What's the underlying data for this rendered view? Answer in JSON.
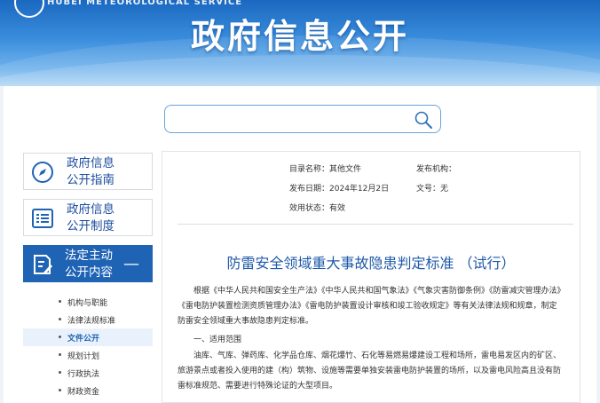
{
  "header": {
    "org_subtitle": "HUBEI METEOROLOGICAL SERVICE",
    "banner_title": "政府信息公开"
  },
  "search": {
    "value": "",
    "placeholder": ""
  },
  "sidebar": {
    "cards": [
      {
        "line1": "政府信息",
        "line2": "公开指南",
        "icon": "compass-icon"
      },
      {
        "line1": "政府信息",
        "line2": "公开制度",
        "icon": "list-document-icon"
      },
      {
        "line1": "法定主动",
        "line2": "公开内容",
        "icon": "edit-document-icon",
        "expanded_marker": "—"
      }
    ],
    "sub_items": [
      "机构与职能",
      "法律法规标准",
      "文件公开",
      "规划计划",
      "行政执法",
      "财政资金"
    ],
    "selected_sub_item": "文件公开"
  },
  "document": {
    "meta": {
      "catalog_label": "目录名称：",
      "catalog_value": "其他文件",
      "publisher_label": "发布机构：",
      "publisher_value": "",
      "date_label": "发布日期：",
      "date_value": "2024年12月2日",
      "docno_label": "文号：",
      "docno_value": "无",
      "status_label": "效用状态：",
      "status_value": "有效"
    },
    "title": "防雷安全领域重大事故隐患判定标准 （试行）",
    "body_intro": "根据《中华人民共和国安全生产法》《中华人民共和国气象法》《气象灾害防御条例》《防雷减灾管理办法》《雷电防护装置检测资质管理办法》《雷电防护装置设计审核和竣工验收规定》等有关法律法规和规章，制定防雷安全领域重大事故隐患判定标准。",
    "section1_heading": "一、适用范围",
    "section1_body": "油库、气库、弹药库、化学品仓库、烟花爆竹、石化等易燃易爆建设工程和场所，雷电易发区内的矿区、旅游景点或者投入使用的建（构）筑物、设施等需要单独安装雷电防护装置的场所，以及雷电风险高且没有防雷标准规范、需要进行特殊论证的大型项目。"
  },
  "colors": {
    "banner_top": "#1a68c0",
    "banner_bottom": "#a9d2f4",
    "accent": "#1f63b5",
    "title_blue": "#1f5aa8"
  }
}
